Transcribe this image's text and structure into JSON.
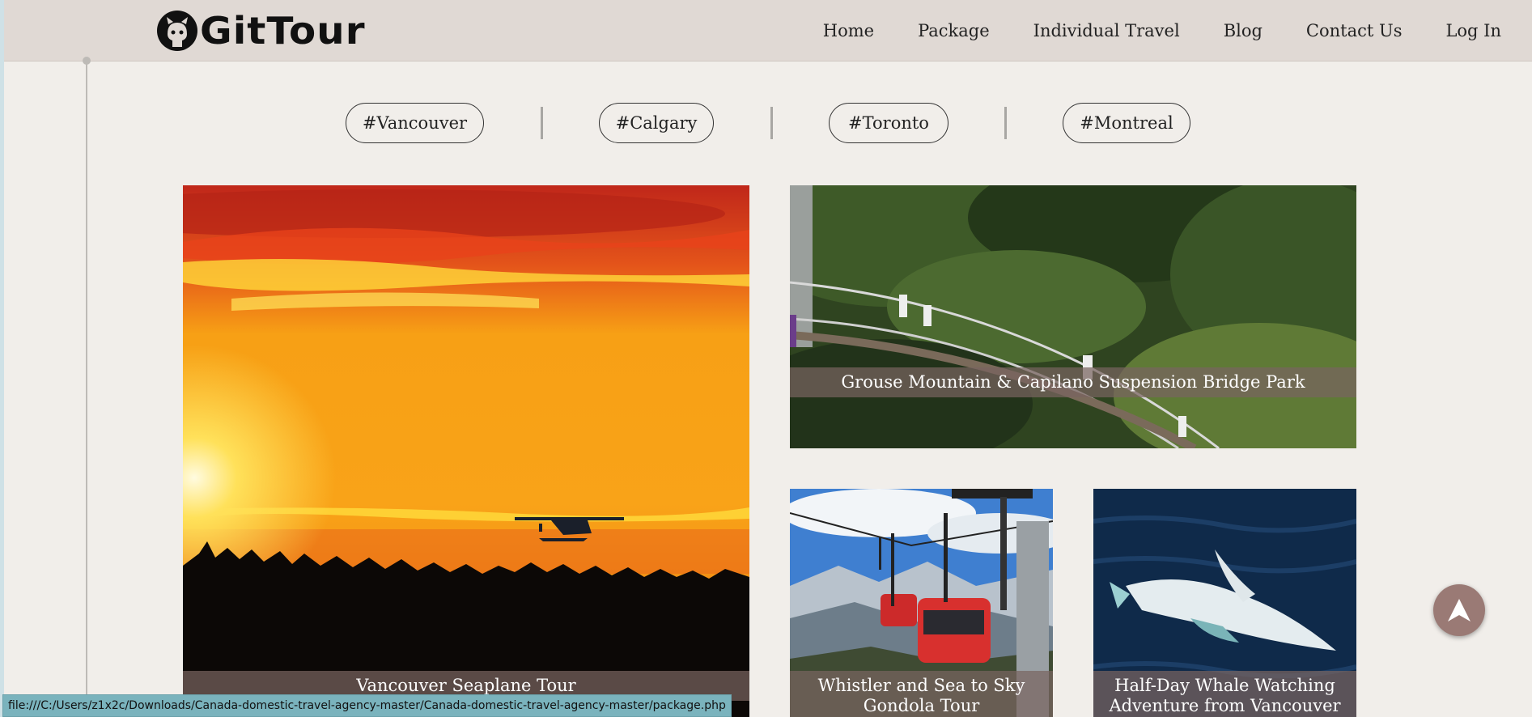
{
  "brand": {
    "name": "GitTour"
  },
  "nav": {
    "items": [
      "Home",
      "Package",
      "Individual Travel",
      "Blog",
      "Contact Us",
      "Log In"
    ]
  },
  "tags": [
    "#Vancouver",
    "#Calgary",
    "#Toronto",
    "#Montreal"
  ],
  "cards": [
    {
      "title": "Vancouver Seaplane Tour"
    },
    {
      "title": "Grouse Mountain & Capilano Suspension Bridge Park"
    },
    {
      "title": "Whistler and Sea to Sky Gondola Tour"
    },
    {
      "title": "Half-Day Whale Watching Adventure from Vancouver"
    }
  ],
  "scroll_top": {
    "icon": "arrow-up-icon"
  },
  "status_bar": {
    "url": "file:///C:/Users/z1x2c/Downloads/Canada-domestic-travel-agency-master/Canada-domestic-travel-agency-master/package.php"
  },
  "colors": {
    "header_bg": "#e0d9d4",
    "page_bg": "#f1eeea",
    "caption_bg": "#78645f",
    "scroll_button": "#9a7a75",
    "status_bg": "#7ab3bd"
  }
}
